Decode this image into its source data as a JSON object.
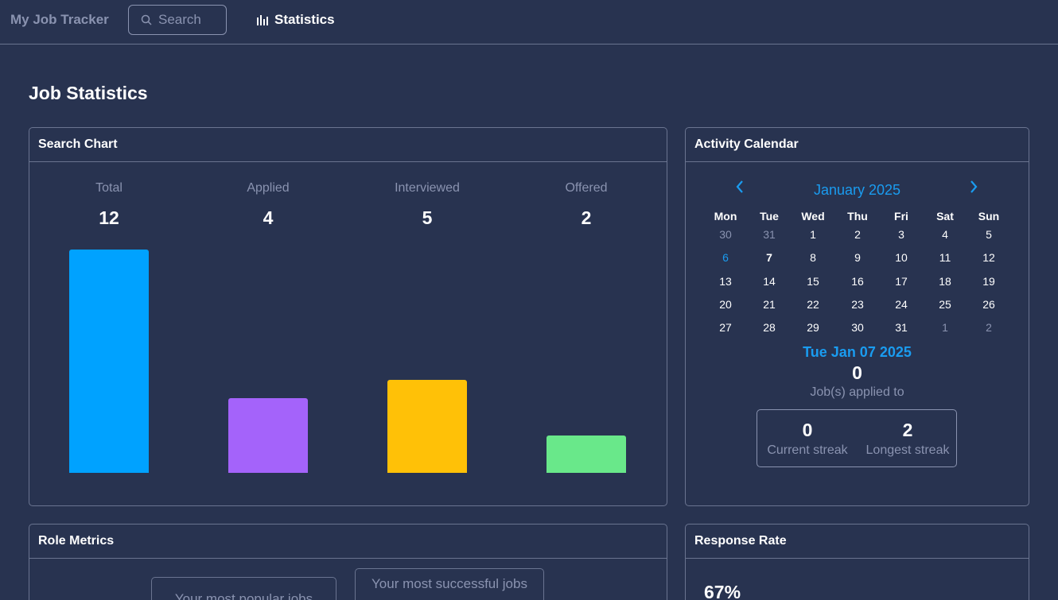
{
  "nav": {
    "brand": "My Job Tracker",
    "search_placeholder": "Search",
    "statistics_label": "Statistics"
  },
  "page_title": "Job Statistics",
  "search_chart": {
    "title": "Search Chart",
    "stats": [
      {
        "label": "Total",
        "value": "12"
      },
      {
        "label": "Applied",
        "value": "4"
      },
      {
        "label": "Interviewed",
        "value": "5"
      },
      {
        "label": "Offered",
        "value": "2"
      }
    ]
  },
  "chart_data": {
    "type": "bar",
    "categories": [
      "Total",
      "Applied",
      "Interviewed",
      "Offered"
    ],
    "values": [
      12,
      4,
      5,
      2
    ],
    "colors": [
      "#00a2ff",
      "#a463fa",
      "#ffc107",
      "#69e88a"
    ],
    "title": "Search Chart",
    "xlabel": "",
    "ylabel": "",
    "ylim": [
      0,
      12
    ]
  },
  "calendar": {
    "title": "Activity Calendar",
    "month_label": "January 2025",
    "prev_label": "‹",
    "next_label": "›",
    "weekdays": [
      "Mon",
      "Tue",
      "Wed",
      "Thu",
      "Fri",
      "Sat",
      "Sun"
    ],
    "weeks": [
      [
        "30",
        "31",
        "1",
        "2",
        "3",
        "4",
        "5"
      ],
      [
        "6",
        "7",
        "8",
        "9",
        "10",
        "11",
        "12"
      ],
      [
        "13",
        "14",
        "15",
        "16",
        "17",
        "18",
        "19"
      ],
      [
        "20",
        "21",
        "22",
        "23",
        "24",
        "25",
        "26"
      ],
      [
        "27",
        "28",
        "29",
        "30",
        "31",
        "1",
        "2"
      ]
    ],
    "selected_date": "Tue Jan 07 2025",
    "selected_count": "0",
    "selected_label": "Job(s) applied to",
    "current_streak": {
      "value": "0",
      "label": "Current streak"
    },
    "longest_streak": {
      "value": "2",
      "label": "Longest streak"
    }
  },
  "role_metrics": {
    "title": "Role Metrics",
    "popular_label": "Your most popular jobs",
    "successful_label": "Your most successful jobs"
  },
  "response_rate": {
    "title": "Response Rate",
    "value": "67%"
  },
  "colors": {
    "background": "#283350",
    "accent": "#1a9cf0",
    "muted": "#8a93b0"
  }
}
